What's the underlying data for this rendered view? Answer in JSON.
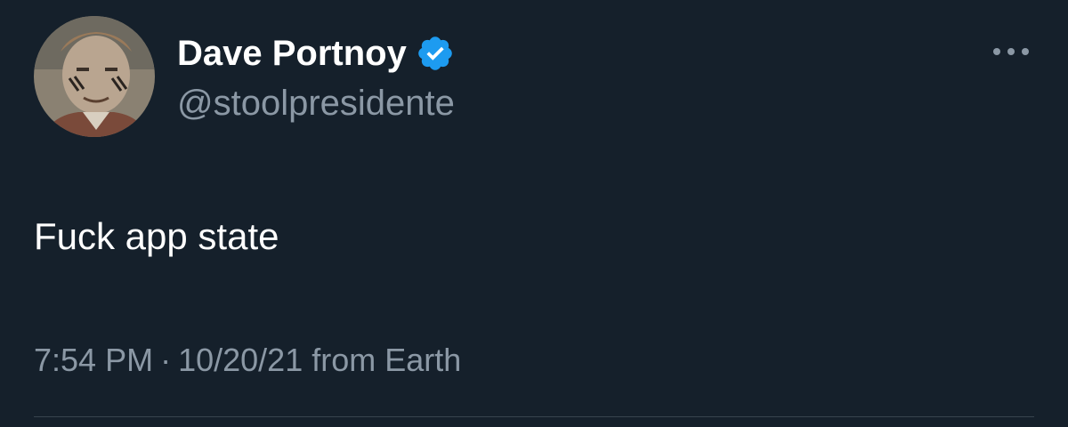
{
  "user": {
    "display_name": "Dave Portnoy",
    "handle": "@stoolpresidente",
    "verified": true
  },
  "tweet": {
    "text": "Fuck app state",
    "time": "7:54 PM",
    "separator": "·",
    "date": "10/20/21",
    "source": "from Earth"
  },
  "icons": {
    "avatar": "profile-photo",
    "verified": "verified-badge-icon",
    "more": "more-options-icon"
  },
  "colors": {
    "background": "#15202b",
    "primary_text": "#ffffff",
    "secondary_text": "#8b98a5",
    "verified_blue": "#1d9bf0",
    "divider": "#38444d"
  }
}
